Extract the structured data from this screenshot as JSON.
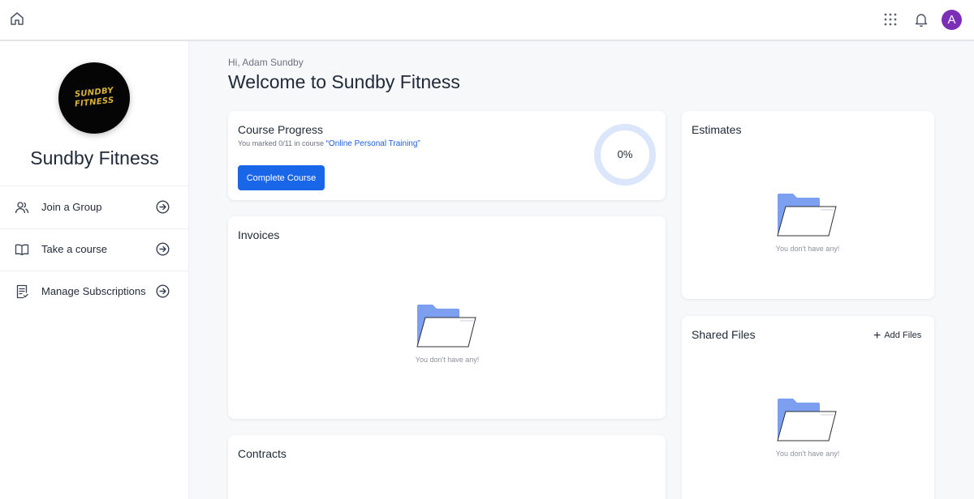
{
  "topbar": {
    "icons": [
      "home-icon",
      "apps-grid-icon",
      "bell-icon"
    ],
    "avatar_initial": "A",
    "avatar_color": "#7b2fb7"
  },
  "sidebar": {
    "logo_line1": "SUNDBY",
    "logo_line2": "FITNESS",
    "brand_name": "Sundby Fitness",
    "items": [
      {
        "label": "Join a Group",
        "icon": "users-icon"
      },
      {
        "label": "Take a course",
        "icon": "book-open-icon"
      },
      {
        "label": "Manage Subscriptions",
        "icon": "document-check-icon"
      }
    ]
  },
  "main": {
    "greeting": "Hi, Adam Sundby",
    "title": "Welcome to Sundby Fitness"
  },
  "course_progress": {
    "title": "Course Progress",
    "subtitle_prefix": "You marked 0/11 in course",
    "course_name": "“Online Personal Training”",
    "button_label": "Complete Course",
    "percent_label": "0%",
    "progress": 0
  },
  "invoices": {
    "title": "Invoices",
    "empty_text": "You don't have any!"
  },
  "contracts": {
    "title": "Contracts"
  },
  "estimates": {
    "title": "Estimates",
    "empty_text": "You don't have any!"
  },
  "shared_files": {
    "title": "Shared Files",
    "add_label": "Add Files",
    "empty_text": "You don't have any!"
  },
  "colors": {
    "accent": "#1a66e8",
    "link": "#1d5fd6",
    "ring": "#dbe6fb",
    "folder_back": "#7d9ff0"
  }
}
